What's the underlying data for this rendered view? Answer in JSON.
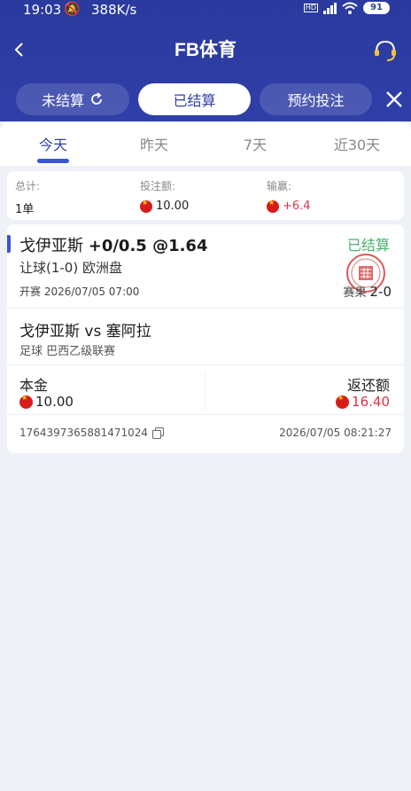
{
  "status_bar": {
    "time": "19:03",
    "speed": "388K/s",
    "network": "HD",
    "battery": "91"
  },
  "header": {
    "title": "FB体育"
  },
  "segments": [
    {
      "label": "未结算",
      "active": false
    },
    {
      "label": "已结算",
      "active": true
    },
    {
      "label": "预约投注",
      "active": false
    }
  ],
  "tabs": [
    {
      "label": "今天",
      "active": true
    },
    {
      "label": "昨天",
      "active": false
    },
    {
      "label": "7天",
      "active": false
    },
    {
      "label": "近30天",
      "active": false
    }
  ],
  "summary": {
    "total_label": "总计:",
    "total_value": "1单",
    "stake_label": "投注额:",
    "stake_value": "10.00",
    "win_label": "输赢:",
    "win_value": "+6.4"
  },
  "bet": {
    "team": "戈伊亚斯",
    "handicap_odds": "+0/0.5 @1.64",
    "status": "已结算",
    "market": "让球(1-0) 欧洲盘",
    "kickoff": "开赛 2026/07/05 07:00",
    "result_label": "赛果",
    "result_score": "2-0",
    "match": "戈伊亚斯 vs 塞阿拉",
    "league": "足球  巴西乙级联赛",
    "principal_label": "本金",
    "principal_value": "10.00",
    "return_label": "返还额",
    "return_value": "16.40",
    "order_id": "1764397365881471024",
    "order_time": "2026/07/05 08:21:27"
  },
  "colors": {
    "header": "#2f3fa8",
    "accent": "#3b55d6",
    "win": "#d8334a",
    "settled": "#4bb06f"
  }
}
